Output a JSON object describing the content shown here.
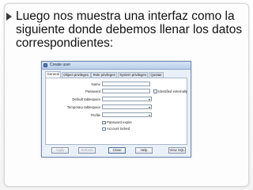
{
  "slide": {
    "bullet_text": "Luego nos muestra una interfaz como la siguiente donde debemos llenar los datos correspondientes:"
  },
  "dialog": {
    "title": "Create user",
    "tabs": [
      {
        "label": "General",
        "active": true
      },
      {
        "label": "Object privileges",
        "active": false
      },
      {
        "label": "Role privileges",
        "active": false
      },
      {
        "label": "System privileges",
        "active": false
      },
      {
        "label": "Quotas",
        "active": false
      }
    ],
    "fields": {
      "name_label": "Name",
      "password_label": "Password",
      "identified_externally_label": "Identified externally",
      "default_tablespace_label": "Default tablespace",
      "temporary_tablespace_label": "Temporary tablespace",
      "profile_label": "Profile",
      "password_expire_label": "Password expire",
      "account_locked_label": "Account locked",
      "name_value": "",
      "password_value": ""
    },
    "buttons": {
      "apply": "Apply",
      "refresh": "Refresh",
      "close": "Close",
      "help": "Help",
      "view_sql": "View SQL"
    }
  },
  "icons": {
    "title_icon": "window-icon",
    "bullet": "triangle-bullet-icon",
    "combo_arrow": "chevron-down-icon"
  }
}
